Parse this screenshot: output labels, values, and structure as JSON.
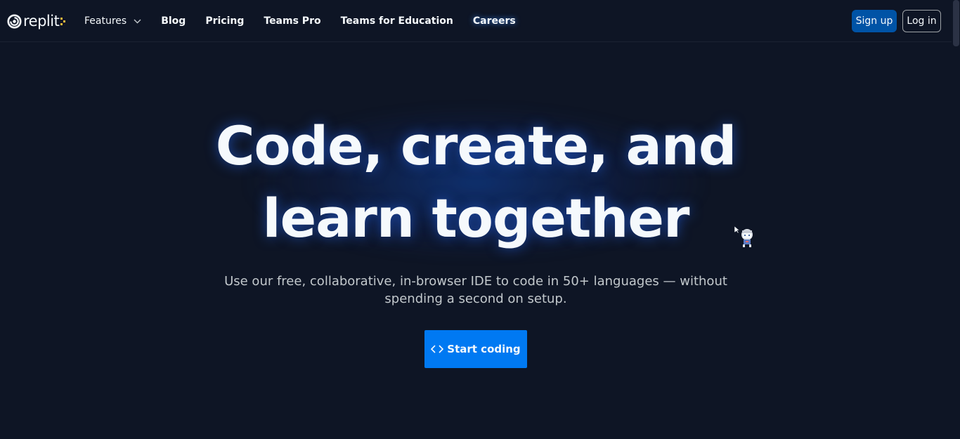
{
  "brand": {
    "name": "replit",
    "accent": "#f5b83d"
  },
  "nav": {
    "items": [
      {
        "label": "Features",
        "has_dropdown": true
      },
      {
        "label": "Blog"
      },
      {
        "label": "Pricing"
      },
      {
        "label": "Teams Pro"
      },
      {
        "label": "Teams for Education"
      },
      {
        "label": "Careers"
      }
    ],
    "signup_label": "Sign up",
    "login_label": "Log in"
  },
  "hero": {
    "title_line1": "Code, create, and",
    "title_line2": "learn together",
    "subtitle_line1": "Use our free, collaborative, in-browser IDE to code in 50+ languages — without",
    "subtitle_line2": "spending a second on setup.",
    "cta_label": "Start coding",
    "cta_icon": "code-icon"
  },
  "colors": {
    "background": "#0e1525",
    "primary_button": "#0079f2",
    "signup_button": "#0053a6",
    "text": "#f5f9fc",
    "subtext": "#c2c8cc"
  }
}
